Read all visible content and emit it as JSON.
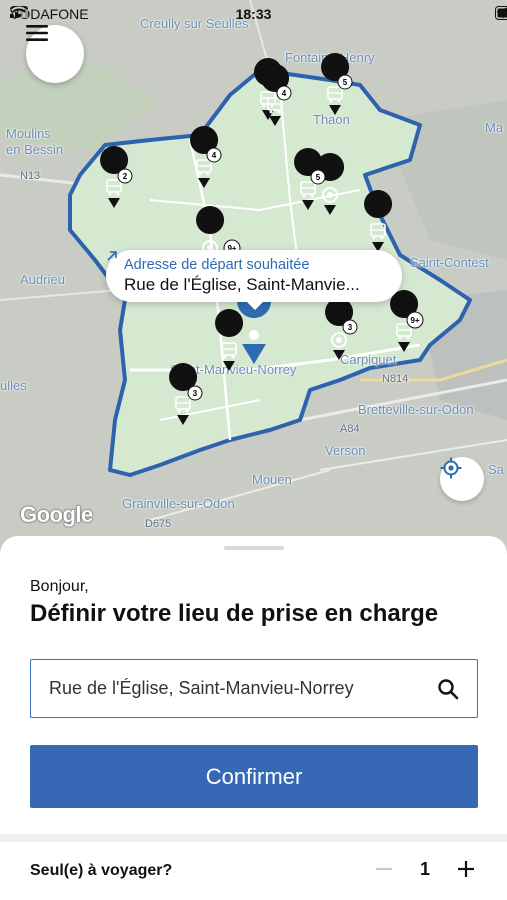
{
  "status_bar": {
    "carrier": "VODAFONE",
    "time": "18:33"
  },
  "map": {
    "places": [
      "Creully sur Seulles",
      "Fontaine-Henry",
      "Thaon",
      "Moulins en Bessin",
      "N13",
      "Audrieu",
      "Saint-Contest",
      "Saint-Manvieu-Norrey",
      "Carpiquet",
      "N814",
      "Bretteville-sur-Odon",
      "A84",
      "Verson",
      "Mouen",
      "Grainville-sur-Odon",
      "D675",
      "ulles",
      "Ma",
      "Sa"
    ],
    "attribution": "Google",
    "stop_counts": [
      "4",
      "5",
      "2",
      "4",
      "5",
      "9+",
      "3",
      "9+",
      "3"
    ]
  },
  "callout": {
    "label": "Adresse de départ souhaitée",
    "value": "Rue de l'Église, Saint-Manvie..."
  },
  "sheet": {
    "greeting": "Bonjour,",
    "title": "Définir votre lieu de prise en charge",
    "search": {
      "value": "Rue de l'Église, Saint-Manvieu-Norrey"
    },
    "confirm_label": "Confirmer",
    "traveler_label": "Seul(e) à voyager?",
    "traveler_count": "1"
  },
  "colors": {
    "accent": "#3768b5",
    "zone_border": "#2d62ad",
    "zone_fill": "#d7ead3"
  },
  "icons": [
    "menu-icon",
    "wifi-icon",
    "signal-icon",
    "battery-icon",
    "location-arrow-icon",
    "search-icon",
    "locate-icon",
    "external-link-icon",
    "bus-stop-icon",
    "target-stop-icon",
    "pin-icon",
    "minus-icon",
    "plus-icon"
  ]
}
